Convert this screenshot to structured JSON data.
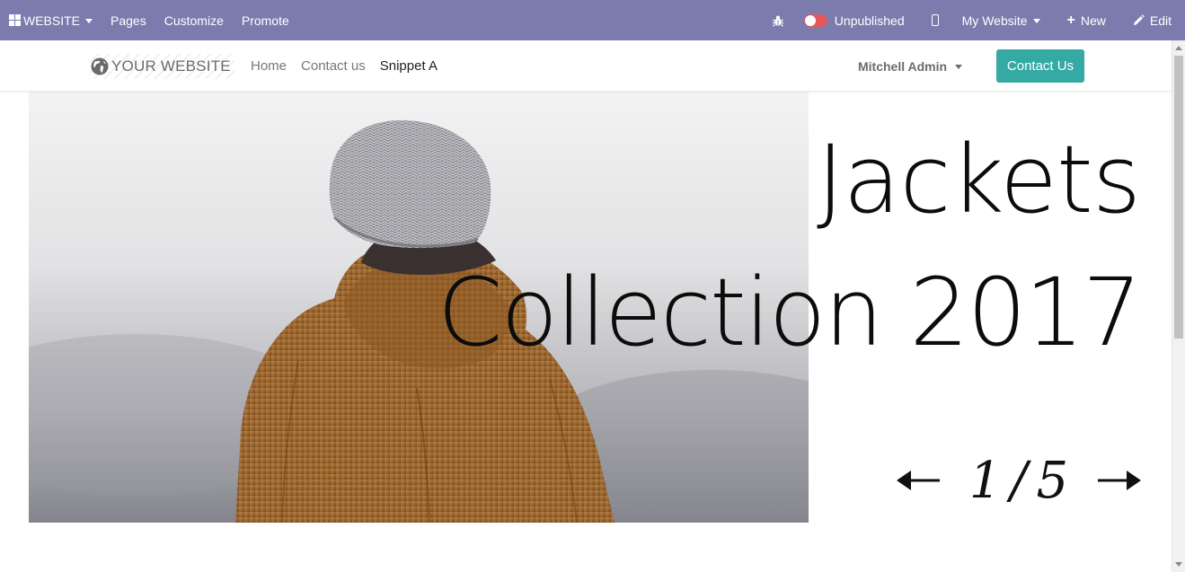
{
  "adminbar": {
    "website_menu": "WEBSITE",
    "pages": "Pages",
    "customize": "Customize",
    "promote": "Promote",
    "publish_status": "Unpublished",
    "site_selector": "My Website",
    "new_label": "New",
    "edit_label": "Edit",
    "bar_color": "#7c7bad",
    "icons": [
      "grid-icon",
      "bug-icon",
      "toggle-icon",
      "mobile-icon",
      "plus-icon",
      "pencil-icon"
    ]
  },
  "header": {
    "logo_text": "YOUR WEBSITE",
    "nav": [
      {
        "label": "Home",
        "active": false
      },
      {
        "label": "Contact us",
        "active": false
      },
      {
        "label": "Snippet A",
        "active": true
      }
    ],
    "user_name": "Mitchell Admin",
    "cta_label": "Contact Us",
    "cta_color": "#35aaa5"
  },
  "hero": {
    "title_line1": "Jackets",
    "title_line2": "Collection 2017",
    "current_slide": "1",
    "slide_separator": "/",
    "total_slides": "5"
  }
}
